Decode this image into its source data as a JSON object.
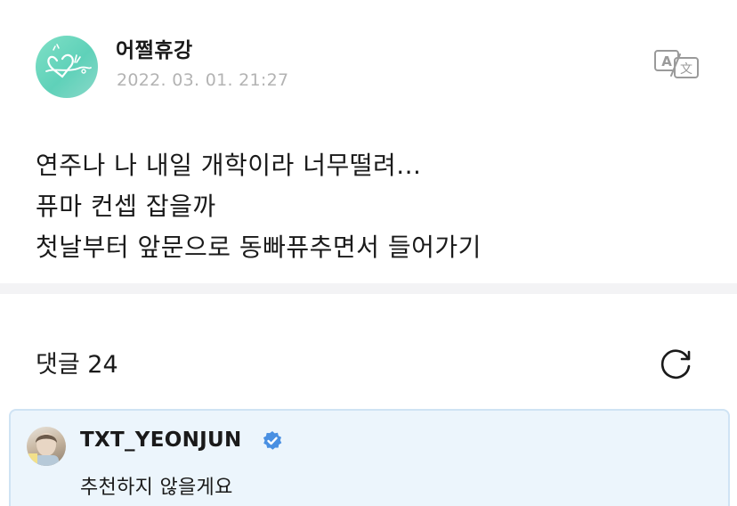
{
  "post": {
    "author": "어쩔휴강",
    "timestamp": "2022. 03. 01. 21:27",
    "lines": [
      "연주나 나 내일 개학이라 너무떨려...",
      "퓨마 컨셉 잡을까",
      "첫날부터 앞문으로 동빠퓨추면서 들어가기"
    ],
    "avatar_icon": "heart-doodle-avatar",
    "translate_icon": "translate-icon"
  },
  "comments": {
    "header": "댓글 24",
    "refresh_icon": "refresh-icon",
    "items": [
      {
        "author": "TXT_YEONJUN",
        "verified": true,
        "text": "추천하지 않을게요",
        "badge_color": "#4a90e2"
      }
    ]
  },
  "colors": {
    "accent_mint": "#6fd6bf",
    "comment_bg": "#ecf5fc",
    "comment_border": "#cfe3f4",
    "timestamp": "#b3b3b3",
    "divider": "#f3f3f5"
  }
}
